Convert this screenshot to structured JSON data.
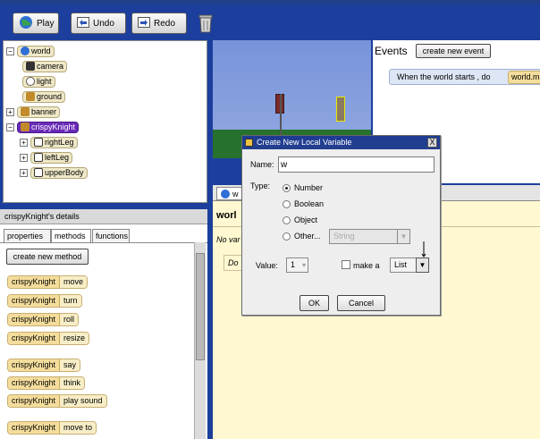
{
  "toolbar": {
    "play_label": "Play",
    "undo_label": "Undo",
    "redo_label": "Redo",
    "icons": [
      "globe-icon",
      "undo-icon",
      "redo-icon",
      "trash-icon"
    ]
  },
  "object_tree": {
    "items": [
      {
        "label": "world"
      },
      {
        "label": "camera"
      },
      {
        "label": "light"
      },
      {
        "label": "ground"
      },
      {
        "label": "banner"
      },
      {
        "label": "crispyKnight",
        "selected": true
      },
      {
        "label": "rightLeg"
      },
      {
        "label": "leftLeg"
      },
      {
        "label": "upperBody"
      }
    ]
  },
  "details": {
    "title": "crispyKnight's details",
    "tabs": [
      "properties",
      "methods",
      "functions"
    ],
    "create_method_label": "create new method",
    "methods": [
      {
        "obj": "crispyKnight",
        "verb": "move"
      },
      {
        "obj": "crispyKnight",
        "verb": "turn"
      },
      {
        "obj": "crispyKnight",
        "verb": "roll"
      },
      {
        "obj": "crispyKnight",
        "verb": "resize"
      },
      {
        "obj": "crispyKnight",
        "verb": "say"
      },
      {
        "obj": "crispyKnight",
        "verb": "think"
      },
      {
        "obj": "crispyKnight",
        "verb": "play sound"
      },
      {
        "obj": "crispyKnight",
        "verb": "move to"
      }
    ]
  },
  "events": {
    "title": "Events",
    "create_event_label": "create new event",
    "event_text": "When the world starts , do",
    "event_target": "world.m"
  },
  "editor": {
    "tab_label": "w",
    "header": "worl",
    "no_var_text": "No var",
    "do_text": "Do"
  },
  "dialog": {
    "title": "Create New Local Variable",
    "close_label": "X",
    "name_label": "Name:",
    "name_value": "w",
    "type_label": "Type:",
    "types": [
      "Number",
      "Boolean",
      "Object",
      "Other..."
    ],
    "selected_type": "Number",
    "other_value": "String",
    "value_label": "Value:",
    "value": "1",
    "make_a_label": "make a",
    "list_value": "List",
    "ok_label": "OK",
    "cancel_label": "Cancel"
  },
  "colors": {
    "toolbar": "#1c3f9e",
    "selection": "#6a2bb8",
    "editor_bg": "#fff8d0"
  }
}
